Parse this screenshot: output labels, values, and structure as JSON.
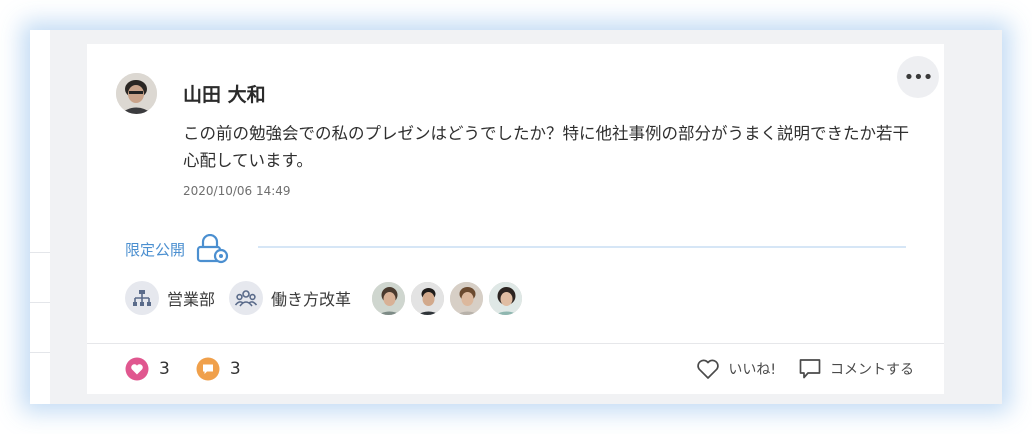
{
  "post": {
    "author": "山田 大和",
    "body": "この前の勉強会での私のプレゼンはどうでしたか？特に他社事例の部分がうまく説明できたか若干心配しています。",
    "timestamp": "2020/10/06 14:49",
    "more_button": "•••",
    "visibility": "限定公開"
  },
  "groups": [
    {
      "label": "営業部",
      "icon": "org-chart-icon"
    },
    {
      "label": "働き方改革",
      "icon": "people-group-icon"
    }
  ],
  "members_count": 4,
  "stats": {
    "likes": "3",
    "comments": "3"
  },
  "actions": {
    "like_label": "いいね!",
    "comment_label": "コメントする"
  },
  "colors": {
    "accent_blue": "#4b8fd0",
    "like_pink": "#e0578f",
    "comment_orange": "#f0a04b",
    "glow": "#78afe6"
  }
}
